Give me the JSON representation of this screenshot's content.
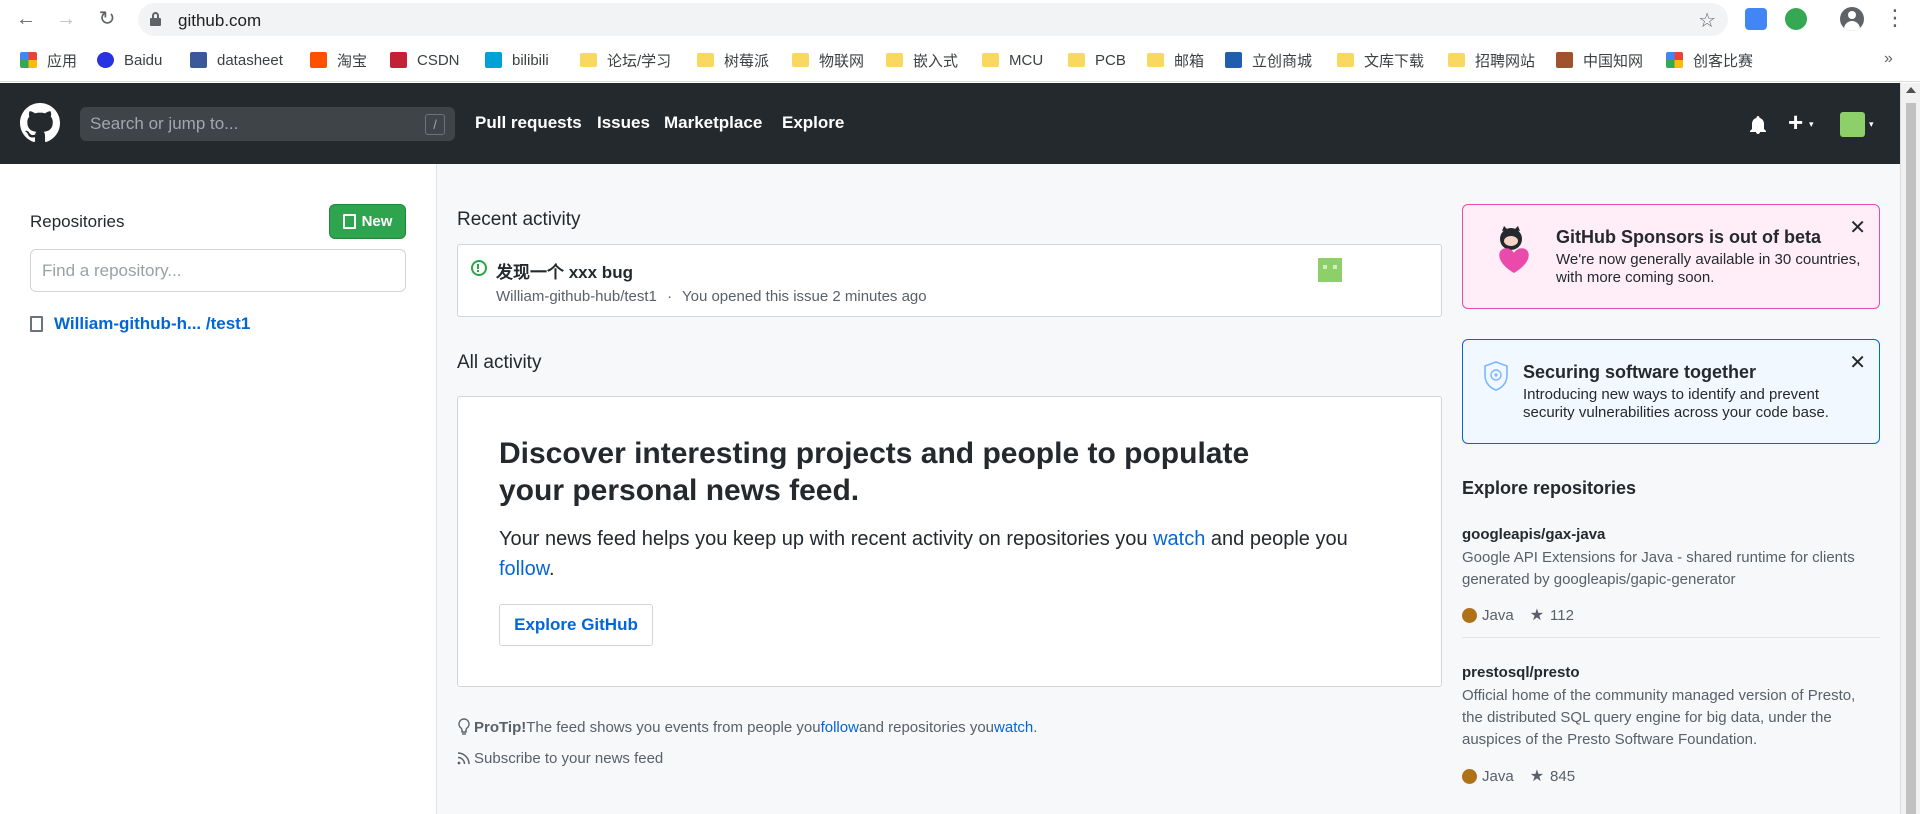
{
  "browser": {
    "url": "github.com",
    "bookmarks": [
      {
        "label": "应用",
        "icon": "apps-grid-icon",
        "color": "#4285f4"
      },
      {
        "label": "Baidu",
        "icon": "baidu-icon",
        "color": "#2932e1"
      },
      {
        "label": "datasheet",
        "icon": "pdf-icon",
        "color": "#3b5998"
      },
      {
        "label": "淘宝",
        "icon": "taobao-icon",
        "color": "#ff5000"
      },
      {
        "label": "CSDN",
        "icon": "csdn-icon",
        "color": "#c32136"
      },
      {
        "label": "bilibili",
        "icon": "bilibili-icon",
        "color": "#00a1d6"
      },
      {
        "label": "论坛/学习",
        "icon": "folder-icon",
        "color": "#f9d860"
      },
      {
        "label": "树莓派",
        "icon": "folder-icon",
        "color": "#f9d860"
      },
      {
        "label": "物联网",
        "icon": "folder-icon",
        "color": "#f9d860"
      },
      {
        "label": "嵌入式",
        "icon": "folder-icon",
        "color": "#f9d860"
      },
      {
        "label": "MCU",
        "icon": "folder-icon",
        "color": "#f9d860"
      },
      {
        "label": "PCB",
        "icon": "folder-icon",
        "color": "#f9d860"
      },
      {
        "label": "邮箱",
        "icon": "folder-icon",
        "color": "#f9d860"
      },
      {
        "label": "立创商城",
        "icon": "lcsc-icon",
        "color": "#1f5fad"
      },
      {
        "label": "文库下载",
        "icon": "folder-icon",
        "color": "#f9d860"
      },
      {
        "label": "招聘网站",
        "icon": "folder-icon",
        "color": "#f9d860"
      },
      {
        "label": "中国知网",
        "icon": "cnki-icon",
        "color": "#a0522d"
      },
      {
        "label": "创客比赛",
        "icon": "maker-icon",
        "color": "#e94235"
      }
    ],
    "more": "»"
  },
  "header": {
    "search_placeholder": "Search or jump to...",
    "slash": "/",
    "nav": [
      "Pull requests",
      "Issues",
      "Marketplace",
      "Explore"
    ],
    "plus": "+",
    "caret": "▾"
  },
  "sidebar": {
    "title": "Repositories",
    "new_label": "New",
    "find_placeholder": "Find a repository...",
    "repo": "William-github-h... /test1"
  },
  "main": {
    "recent_title": "Recent activity",
    "issue_title": "发现一个 xxx bug",
    "issue_repo": "William-github-hub/test1",
    "issue_sep": "·",
    "issue_time": "You opened this issue 2 minutes ago",
    "all_title": "All activity",
    "discover_title": "Discover interesting projects and people to populate your personal news feed.",
    "discover_text_1": "Your news feed helps you keep up with recent activity on repositories you ",
    "discover_link_watch": "watch",
    "discover_text_2": " and people you ",
    "discover_link_follow": "follow",
    "discover_text_3": ".",
    "explore_btn": "Explore GitHub",
    "protip_label": "ProTip!",
    "protip_text_1": " The feed shows you events from people you ",
    "protip_link_follow": "follow",
    "protip_text_2": " and repositories you ",
    "protip_link_watch": "watch",
    "protip_text_3": ".",
    "subscribe": "Subscribe to your news feed"
  },
  "right": {
    "sponsors_title": "GitHub Sponsors is out of beta",
    "sponsors_text_1": "We're now generally available in 30 countries,",
    "sponsors_text_2": "with more coming soon.",
    "security_title": "Securing software together",
    "security_text_1": "Introducing new ways to identify and prevent",
    "security_text_2": "security vulnerabilities across your code base.",
    "close": "✕",
    "explore_title": "Explore repositories",
    "repos": [
      {
        "name": "googleapis/gax-java",
        "desc_1": "Google API Extensions for Java - shared runtime for clients",
        "desc_2": "generated by googleapis/gapic-generator",
        "language": "Java",
        "stars": "112"
      },
      {
        "name": "prestosql/presto",
        "desc_1": "Official home of the community managed version of Presto,",
        "desc_2": "the distributed SQL query engine for big data, under the",
        "desc_3": "auspices of the Presto Software Foundation.",
        "language": "Java",
        "stars": "845"
      }
    ]
  },
  "colors": {
    "header_bg": "#24292e",
    "green_button": "#2ea44f",
    "link": "#0366d6",
    "java": "#b07219",
    "sponsors_border": "#ea4aaa"
  }
}
